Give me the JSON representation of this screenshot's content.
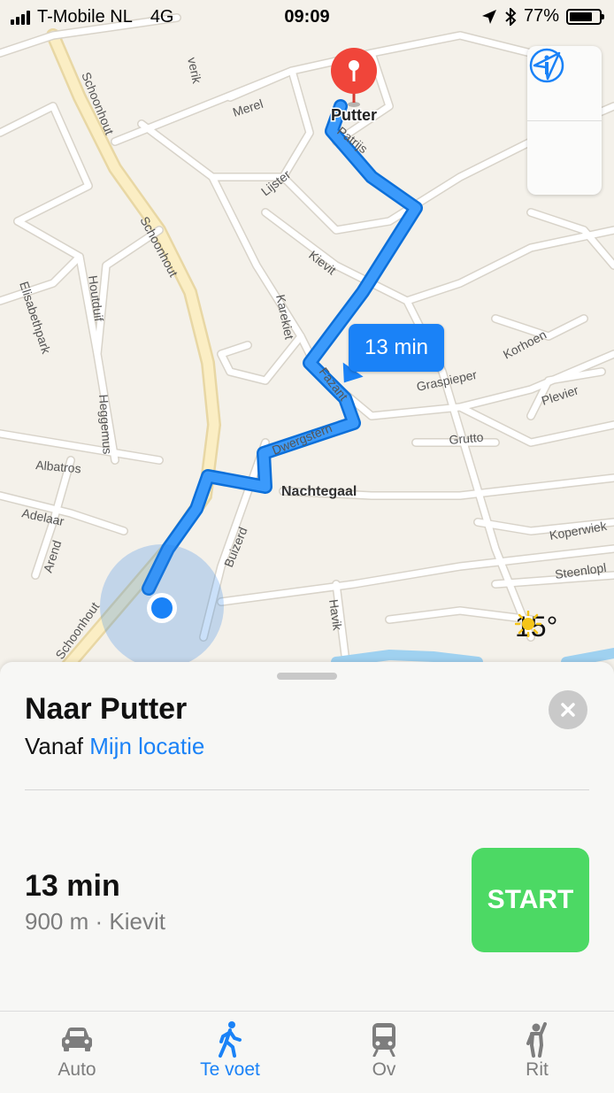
{
  "status_bar": {
    "carrier": "T-Mobile NL",
    "network": "4G",
    "time": "09:09",
    "battery": "77%",
    "battery_level": 0.77
  },
  "map": {
    "destination_pin_label": "Putter",
    "eta_bubble": "13 min",
    "streets": [
      "Merel",
      "Lijster",
      "Patrijs",
      "Kievit",
      "Karekiet",
      "Fazant",
      "Dwergstern",
      "Nachtegaal",
      "Buizerd",
      "Havik",
      "Schoonhout",
      "Schoonhout",
      "Schoonhout",
      "Elisabethpark",
      "Houtduif",
      "Heggemus",
      "Albatros",
      "Adelaar",
      "Arend",
      "Graspieper",
      "Korhoen",
      "Plevier",
      "Grutto",
      "Koperwiek",
      "Steenlopl",
      "verik"
    ],
    "weather": {
      "temperature": "15°",
      "icon": "sun-icon"
    },
    "controls": {
      "info_icon": "info-icon",
      "location_icon": "location-arrow-icon"
    }
  },
  "sheet": {
    "title": "Naar Putter",
    "from_label": "Vanaf",
    "from_value": "Mijn locatie",
    "route_time": "13 min",
    "route_detail": "900 m · Kievit",
    "start_label": "START"
  },
  "tabs": [
    {
      "label": "Auto",
      "icon": "car-icon",
      "active": false
    },
    {
      "label": "Te voet",
      "icon": "walking-icon",
      "active": true
    },
    {
      "label": "Ov",
      "icon": "train-icon",
      "active": false
    },
    {
      "label": "Rit",
      "icon": "ride-icon",
      "active": false
    }
  ],
  "colors": {
    "accent": "#1a82f7",
    "start": "#4cd964",
    "pin": "#f0453a",
    "route": "#1a82f7"
  }
}
